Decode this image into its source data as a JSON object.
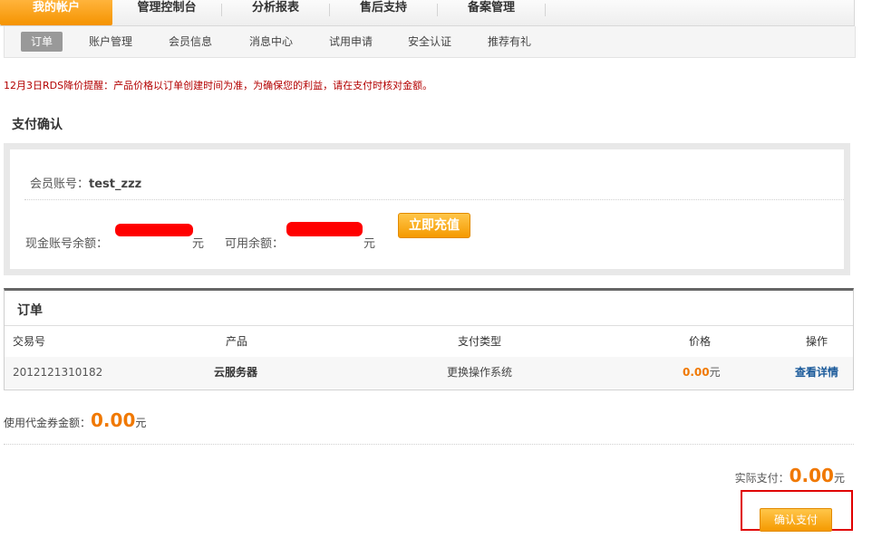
{
  "nav": {
    "tabs": [
      {
        "label": "我的帐户",
        "active": true
      },
      {
        "label": "管理控制台"
      },
      {
        "label": "分析报表"
      },
      {
        "label": "售后支持"
      },
      {
        "label": "备案管理"
      }
    ]
  },
  "subnav": {
    "items": [
      {
        "label": "订单",
        "active": true
      },
      {
        "label": "账户管理"
      },
      {
        "label": "会员信息"
      },
      {
        "label": "消息中心"
      },
      {
        "label": "试用申请"
      },
      {
        "label": "安全认证"
      },
      {
        "label": "推荐有礼"
      }
    ]
  },
  "notice": "12月3日RDS降价提醒：产品价格以订单创建时间为准，为确保您的利益，请在支付时核对金额。",
  "pay_confirm": {
    "title": "支付确认",
    "member_label": "会员账号：",
    "member_value": "test_zzz",
    "cash_balance_label": "现金账号余额：",
    "available_balance_label": "可用余额：",
    "yuan": "元",
    "recharge_button": "立即充值"
  },
  "orders": {
    "title": "订单",
    "columns": [
      "交易号",
      "产品",
      "支付类型",
      "价格",
      "操作"
    ],
    "rows": [
      {
        "id": "2012121310182",
        "product": "云服务器",
        "pay_type": "更换操作系统",
        "price": "0.00",
        "currency": "元",
        "action": "查看详情"
      }
    ]
  },
  "coupon": {
    "label": "使用代金券金额：",
    "amount": "0.00",
    "currency": "元"
  },
  "actual_pay": {
    "label": "实际支付：",
    "amount": "0.00",
    "currency": "元"
  },
  "confirm_button": "确认支付",
  "colors": {
    "accent": "#f59300",
    "price": "#f07800",
    "notice": "#b30000",
    "highlight_box": "#e00000"
  }
}
